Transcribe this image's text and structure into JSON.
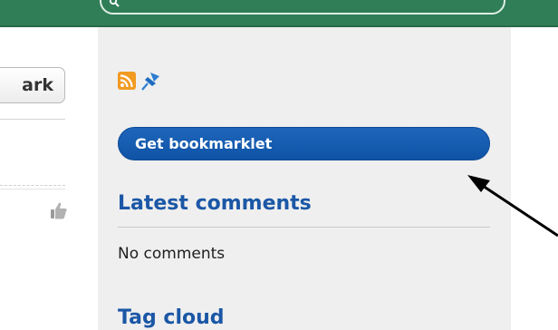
{
  "header": {
    "search": {
      "icon": "search-icon"
    }
  },
  "left_column": {
    "bookmark_button_label": "ark",
    "thumb_icon": "thumbs-up-icon"
  },
  "sidebar": {
    "feed_icons": [
      "rss-feed-icon",
      "pin-icon"
    ],
    "bookmarklet_button_label": "Get bookmarklet",
    "latest_comments": {
      "heading": "Latest comments",
      "empty_text": "No comments"
    },
    "tag_cloud": {
      "heading": "Tag cloud"
    }
  },
  "colors": {
    "header_green": "#2f7e57",
    "sidebar_bg": "#efefef",
    "primary_blue": "#0e53a6",
    "heading_blue": "#1b57a6",
    "rss_orange": "#f29a22"
  }
}
